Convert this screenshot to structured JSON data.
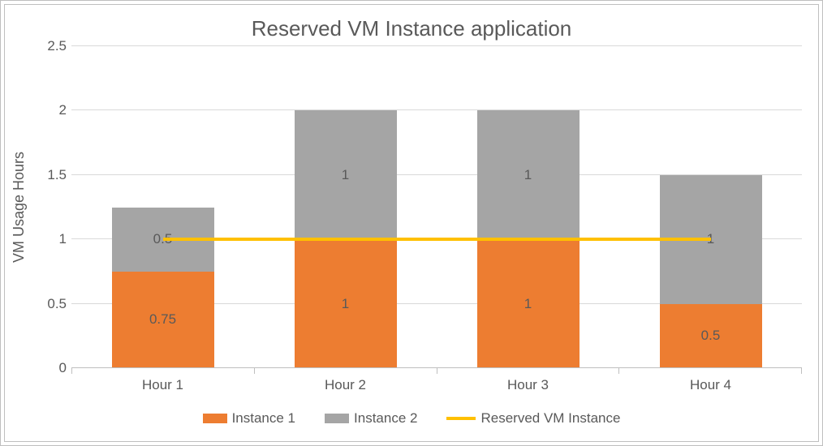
{
  "chart_data": {
    "type": "bar",
    "stacked": true,
    "title": "Reserved VM Instance application",
    "ylabel": "VM Usage Hours",
    "xlabel": "",
    "ylim": [
      0,
      2.5
    ],
    "yticks": [
      0,
      0.5,
      1,
      1.5,
      2,
      2.5
    ],
    "categories": [
      "Hour 1",
      "Hour 2",
      "Hour 3",
      "Hour 4"
    ],
    "series": [
      {
        "name": "Instance 1",
        "values": [
          0.75,
          1,
          1,
          0.5
        ],
        "color": "#ed7d31"
      },
      {
        "name": "Instance 2",
        "values": [
          0.5,
          1,
          1,
          1
        ],
        "color": "#a5a5a5"
      }
    ],
    "line_series": {
      "name": "Reserved VM Instance",
      "values": [
        1,
        1,
        1,
        1
      ],
      "color": "#ffc000"
    },
    "legend": [
      "Instance 1",
      "Instance 2",
      "Reserved VM Instance"
    ]
  }
}
